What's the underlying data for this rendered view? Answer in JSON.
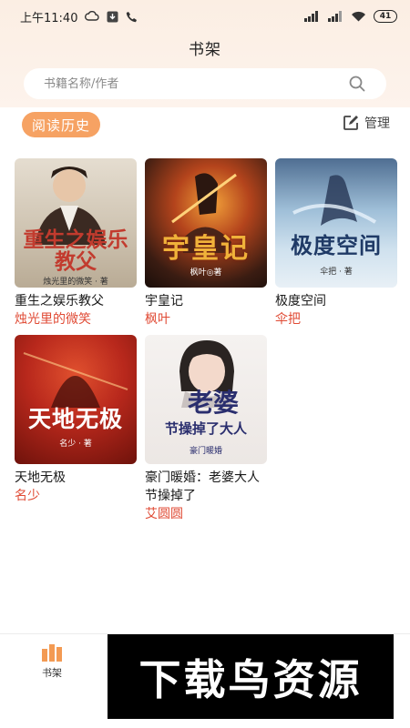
{
  "status_bar": {
    "time": "上午11:40",
    "battery": "41"
  },
  "header": {
    "title": "书架"
  },
  "search": {
    "placeholder": "书籍名称/作者"
  },
  "toolbar": {
    "history_label": "阅读历史",
    "manage_label": "管理"
  },
  "books": [
    {
      "title": "重生之娱乐教父",
      "author": "烛光里的微笑",
      "cover_title": "重生之娱乐教父",
      "cover_author": "烛光里的微笑 · 著",
      "colors": {
        "bg": "#d9d2c4",
        "accent": "#c23b2e"
      }
    },
    {
      "title": "宇皇记",
      "author": "枫叶",
      "cover_title": "宇皇记",
      "cover_author": "枫叶◎著",
      "colors": {
        "bg": "#3a1c12",
        "accent": "#f0b23a"
      }
    },
    {
      "title": "极度空间",
      "author": "伞把",
      "cover_title": "极度空间",
      "cover_author": "伞把 · 著",
      "colors": {
        "bg": "#a9c6de",
        "accent": "#1f3a66"
      }
    },
    {
      "title": "天地无极",
      "author": "名少",
      "cover_title": "天地无极",
      "cover_author": "名少 · 著",
      "colors": {
        "bg": "#b8281c",
        "accent": "#ffffff"
      }
    },
    {
      "title": "豪门暖婚：老婆大人节操掉了",
      "author": "艾圆圆",
      "cover_title_top": "老婆",
      "cover_title_bottom": "节操掉了大人",
      "cover_subtitle": "豪门暖婚",
      "colors": {
        "bg": "#f1eeec",
        "accent": "#2a2e6e"
      }
    }
  ],
  "bottom_nav": {
    "shelf_label": "书架"
  },
  "watermark": {
    "text": "下载鸟资源"
  }
}
